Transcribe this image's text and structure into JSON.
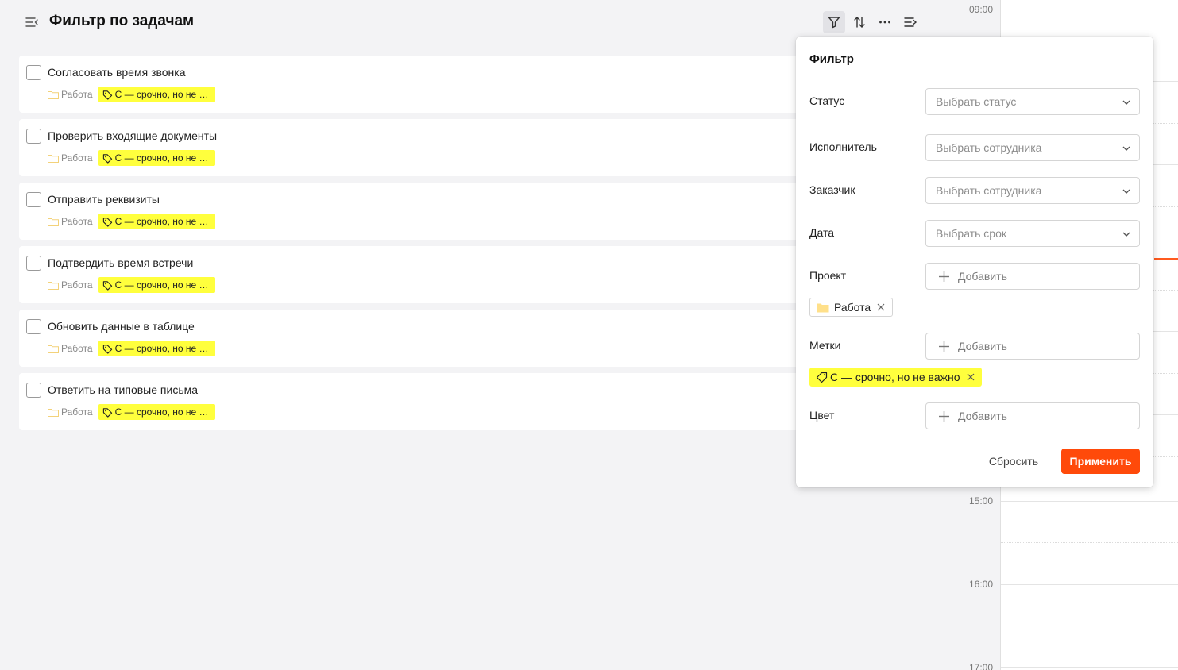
{
  "header": {
    "title": "Фильтр по задачам"
  },
  "tasks": [
    {
      "title": "Согласовать время звонка",
      "project": "Работа",
      "tag": "С — срочно, но не в..."
    },
    {
      "title": "Проверить входящие документы",
      "project": "Работа",
      "tag": "С — срочно, но не в..."
    },
    {
      "title": "Отправить реквизиты",
      "project": "Работа",
      "tag": "С — срочно, но не в..."
    },
    {
      "title": "Подтвердить время встречи",
      "project": "Работа",
      "tag": "С — срочно, но не в..."
    },
    {
      "title": "Обновить данные в таблице",
      "project": "Работа",
      "tag": "С — срочно, но не в..."
    },
    {
      "title": "Ответить на типовые письма",
      "project": "Работа",
      "tag": "С — срочно, но не в..."
    }
  ],
  "calendar": {
    "hours": [
      "09:00",
      "15:00",
      "16:00",
      "17:00"
    ]
  },
  "filter": {
    "title": "Фильтр",
    "status": {
      "label": "Статус",
      "placeholder": "Выбрать статус"
    },
    "assignee": {
      "label": "Исполнитель",
      "placeholder": "Выбрать сотрудника"
    },
    "customer": {
      "label": "Заказчик",
      "placeholder": "Выбрать сотрудника"
    },
    "date": {
      "label": "Дата",
      "placeholder": "Выбрать срок"
    },
    "project": {
      "label": "Проект",
      "add_label": "Добавить",
      "selected": "Работа"
    },
    "tags": {
      "label": "Метки",
      "add_label": "Добавить",
      "selected": "С — срочно, но не важно"
    },
    "color": {
      "label": "Цвет",
      "add_label": "Добавить"
    },
    "reset_label": "Сбросить",
    "apply_label": "Применить"
  },
  "colors": {
    "accent": "#ff4a0a",
    "tag_yellow": "#ffff3d",
    "folder_yellow": "#ffe08a"
  }
}
